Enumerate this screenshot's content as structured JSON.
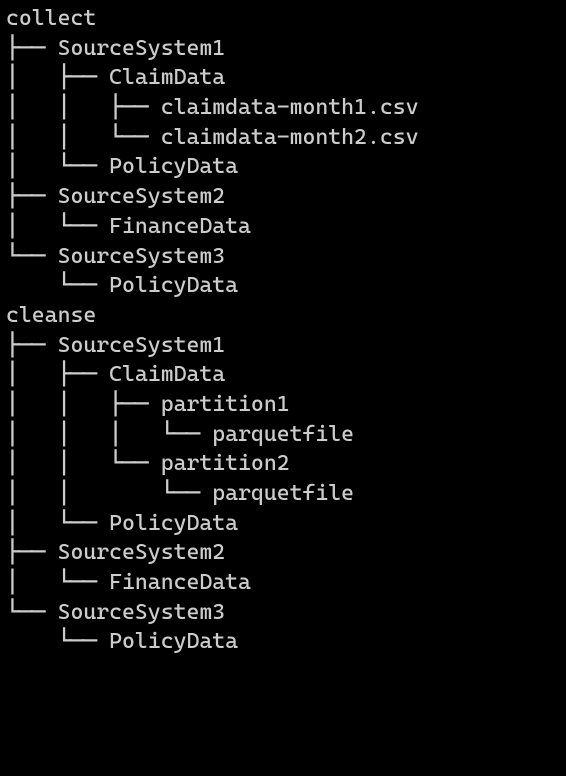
{
  "tree_lines": [
    {
      "prefix": "",
      "name": "collect"
    },
    {
      "prefix": "├── ",
      "name": "SourceSystem1"
    },
    {
      "prefix": "│   ├── ",
      "name": "ClaimData"
    },
    {
      "prefix": "│   │   ├── ",
      "name": "claimdata-month1.csv"
    },
    {
      "prefix": "│   │   └── ",
      "name": "claimdata-month2.csv"
    },
    {
      "prefix": "│   └── ",
      "name": "PolicyData"
    },
    {
      "prefix": "├── ",
      "name": "SourceSystem2"
    },
    {
      "prefix": "│   └── ",
      "name": "FinanceData"
    },
    {
      "prefix": "└── ",
      "name": "SourceSystem3"
    },
    {
      "prefix": "    └── ",
      "name": "PolicyData"
    },
    {
      "prefix": "",
      "name": "cleanse"
    },
    {
      "prefix": "├── ",
      "name": "SourceSystem1"
    },
    {
      "prefix": "│   ├── ",
      "name": "ClaimData"
    },
    {
      "prefix": "│   │   ├── ",
      "name": "partition1"
    },
    {
      "prefix": "│   │   │   └── ",
      "name": "parquetfile"
    },
    {
      "prefix": "│   │   └── ",
      "name": "partition2"
    },
    {
      "prefix": "│   │       └── ",
      "name": "parquetfile"
    },
    {
      "prefix": "│   └── ",
      "name": "PolicyData"
    },
    {
      "prefix": "├── ",
      "name": "SourceSystem2"
    },
    {
      "prefix": "│   └── ",
      "name": "FinanceData"
    },
    {
      "prefix": "└── ",
      "name": "SourceSystem3"
    },
    {
      "prefix": "    └── ",
      "name": "PolicyData"
    }
  ]
}
